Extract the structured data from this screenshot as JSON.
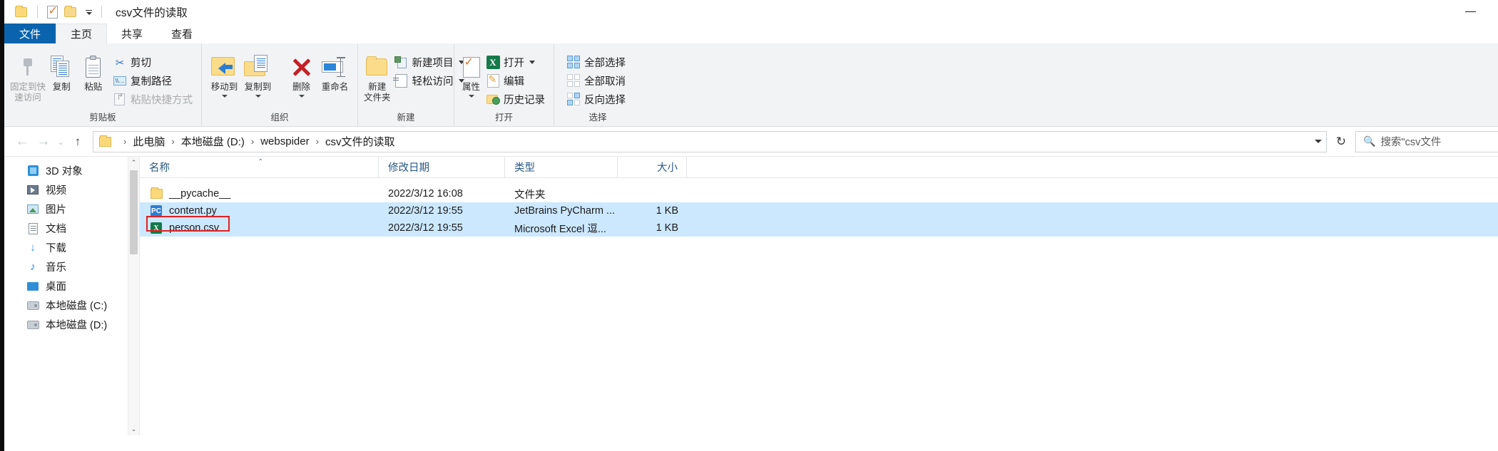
{
  "window": {
    "title": "csv文件的读取",
    "minimize_label": "—",
    "qat": [
      {
        "name": "folder-icon",
        "label": "文件夹"
      },
      {
        "name": "properties-icon",
        "label": "属性"
      },
      {
        "name": "new-folder-icon",
        "label": "新建文件夹"
      },
      {
        "name": "customize-qat-caret",
        "label": "自定义快速访问工具栏"
      }
    ]
  },
  "tabs": [
    {
      "label": "文件",
      "state": "file"
    },
    {
      "label": "主页",
      "state": "active"
    },
    {
      "label": "共享",
      "state": "normal"
    },
    {
      "label": "查看",
      "state": "normal"
    }
  ],
  "ribbon": {
    "groups": [
      {
        "title": "剪贴板",
        "big": [
          {
            "label_line1": "固定到快",
            "label_line2": "速访问",
            "icon": "pin-icon",
            "disabled": true
          },
          {
            "label_line1": "复制",
            "label_line2": "",
            "icon": "copy-icon",
            "disabled": false
          },
          {
            "label_line1": "粘贴",
            "label_line2": "",
            "icon": "paste-icon",
            "disabled": false
          }
        ],
        "small": [
          {
            "label": "剪切",
            "icon": "scissors-icon",
            "disabled": false
          },
          {
            "label": "复制路径",
            "icon": "copy-path-icon",
            "disabled": false
          },
          {
            "label": "粘贴快捷方式",
            "icon": "paste-shortcut-icon",
            "disabled": true
          }
        ]
      },
      {
        "title": "组织",
        "big": [
          {
            "label_line1": "移动到",
            "label_line2": "",
            "icon": "move-to-icon",
            "caret": true
          },
          {
            "label_line1": "复制到",
            "label_line2": "",
            "icon": "copy-to-icon",
            "caret": true
          }
        ]
      },
      {
        "title": "",
        "big": [
          {
            "label_line1": "删除",
            "label_line2": "",
            "icon": "delete-icon",
            "caret": true
          },
          {
            "label_line1": "重命名",
            "label_line2": "",
            "icon": "rename-icon",
            "caret": false
          }
        ]
      },
      {
        "title": "新建",
        "big": [
          {
            "label_line1": "新建",
            "label_line2": "文件夹",
            "icon": "new-folder-icon",
            "caret": false
          }
        ],
        "small": [
          {
            "label": "新建项目",
            "icon": "new-item-icon",
            "caret": true
          },
          {
            "label": "轻松访问",
            "icon": "easy-access-icon",
            "caret": true
          }
        ]
      },
      {
        "title": "打开",
        "big": [
          {
            "label_line1": "属性",
            "label_line2": "",
            "icon": "properties-icon",
            "caret": true
          }
        ],
        "small": [
          {
            "label": "打开",
            "icon": "excel-icon",
            "caret": true
          },
          {
            "label": "编辑",
            "icon": "edit-icon",
            "caret": false
          },
          {
            "label": "历史记录",
            "icon": "history-icon",
            "caret": false
          }
        ]
      },
      {
        "title": "选择",
        "small": [
          {
            "label": "全部选择",
            "icon": "select-all-icon"
          },
          {
            "label": "全部取消",
            "icon": "select-none-icon"
          },
          {
            "label": "反向选择",
            "icon": "invert-selection-icon"
          }
        ]
      }
    ]
  },
  "address": {
    "back_label": "←",
    "forward_label": "→",
    "recent_label": "⌄",
    "up_label": "↑",
    "refresh_label": "↻",
    "dropdown_label": "⌄",
    "breadcrumb": [
      "此电脑",
      "本地磁盘 (D:)",
      "webspider",
      "csv文件的读取"
    ],
    "separator": "›",
    "search_placeholder": "搜索\"csv文件",
    "search_icon": "search-icon"
  },
  "navpane": {
    "items": [
      {
        "label": "3D 对象",
        "icon": "3d-objects-icon"
      },
      {
        "label": "视频",
        "icon": "videos-icon"
      },
      {
        "label": "图片",
        "icon": "pictures-icon"
      },
      {
        "label": "文档",
        "icon": "documents-icon"
      },
      {
        "label": "下载",
        "icon": "downloads-icon"
      },
      {
        "label": "音乐",
        "icon": "music-icon"
      },
      {
        "label": "桌面",
        "icon": "desktop-icon"
      },
      {
        "label": "本地磁盘 (C:)",
        "icon": "disk-icon"
      },
      {
        "label": "本地磁盘 (D:)",
        "icon": "disk-icon"
      }
    ],
    "scroll_up": "⌃",
    "scroll_down": "⌄"
  },
  "filelist": {
    "columns": [
      {
        "label": "名称",
        "key": "name"
      },
      {
        "label": "修改日期",
        "key": "date"
      },
      {
        "label": "类型",
        "key": "type"
      },
      {
        "label": "大小",
        "key": "size"
      }
    ],
    "sort_indicator": "⌃",
    "rows": [
      {
        "name": "__pycache__",
        "date": "2022/3/12 16:08",
        "type": "文件夹",
        "size": "",
        "icon": "folder-icon",
        "selected": false
      },
      {
        "name": "content.py",
        "date": "2022/3/12 19:55",
        "type": "JetBrains PyCharm ...",
        "size": "1 KB",
        "icon": "python-file-icon",
        "selected": true
      },
      {
        "name": "person.csv",
        "date": "2022/3/12 19:55",
        "type": "Microsoft Excel 逗...",
        "size": "1 KB",
        "icon": "csv-file-icon",
        "selected": true
      }
    ],
    "highlight": {
      "target": "person.csv",
      "color": "#e02121"
    }
  },
  "colors": {
    "file_tab": "#0a64ad",
    "selection": "#cce8ff",
    "annotation": "#e02121",
    "column_header_text": "#2a5a86"
  }
}
